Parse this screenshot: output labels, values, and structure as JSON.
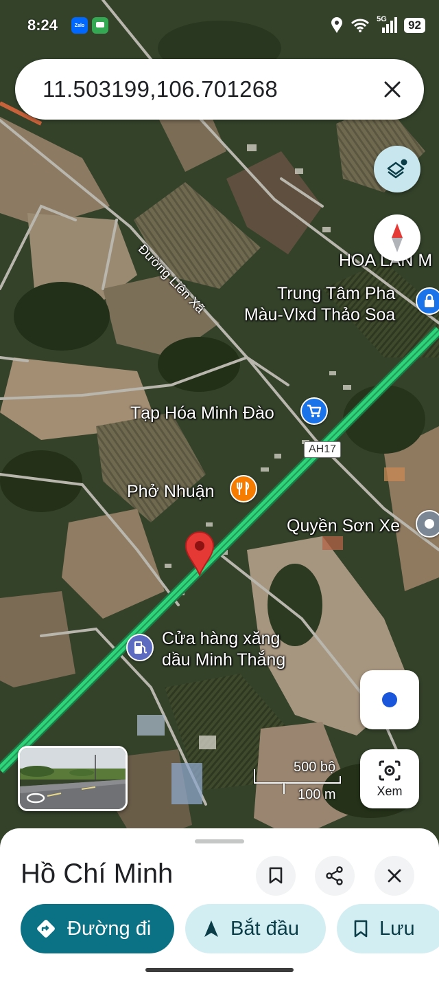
{
  "status_bar": {
    "time": "8:24",
    "apps": [
      "Zalo",
      "messages"
    ],
    "network": "5G",
    "battery": "92"
  },
  "search": {
    "value": "11.503199,106.701268"
  },
  "map": {
    "road_labels": [
      "Đường Liên Xã"
    ],
    "route_shield": "AH17",
    "places": {
      "hoa_lan": "HOA LAN M",
      "trung_tam_line1": "Trung Tâm Pha",
      "trung_tam_line2": "Màu-Vlxd Thảo Soa",
      "tap_hoa": "Tạp Hóa Minh Đào",
      "pho": "Phở Nhuận",
      "quyen_son": "Quyền Sơn Xe",
      "cua_hang_line1": "Cửa hàng xăng",
      "cua_hang_line2": "dầu Minh Thắng"
    },
    "scale": {
      "imperial": "500 bộ",
      "metric": "100 m"
    },
    "colors": {
      "highway": "#2fd37a",
      "pin": "#e53935",
      "poi_blue": "#1a73e8",
      "poi_orange": "#f57c00",
      "poi_gray": "#7b8794"
    }
  },
  "buttons": {
    "lens_label": "Xem"
  },
  "sheet": {
    "title": "Hồ Chí Minh",
    "directions_label": "Đường đi",
    "start_label": "Bắt đầu",
    "save_label": "Lưu"
  },
  "icons": [
    "layers-icon",
    "compass-icon",
    "my-location-icon",
    "lens-icon",
    "bookmark-icon",
    "share-icon",
    "close-icon",
    "directions-icon",
    "navigation-arrow-icon",
    "map-pin-icon",
    "shopping-cart-icon",
    "restaurant-icon",
    "gas-station-icon",
    "lock-icon"
  ]
}
